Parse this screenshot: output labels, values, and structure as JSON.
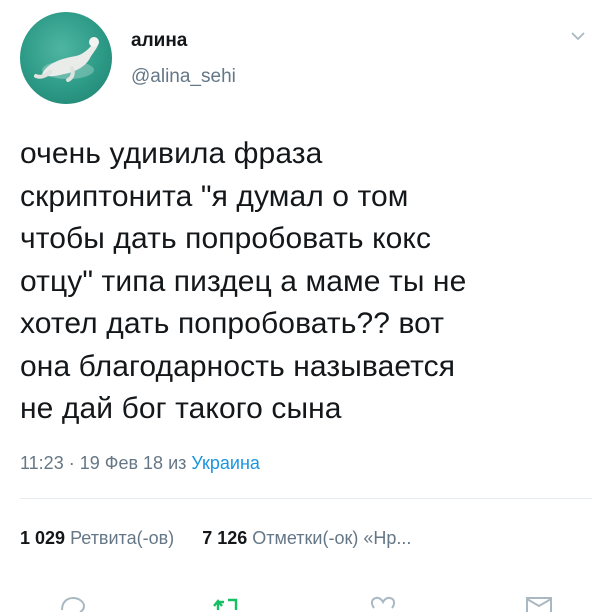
{
  "user": {
    "display_name": "алина",
    "handle": "@alina_sehi"
  },
  "tweet": {
    "lines": [
      "очень удивила фраза",
      "скриптонита \"я думал о том",
      "чтобы дать попробовать кокс",
      "отцу\" типа пиздец а маме ты не",
      "хотел дать попробовать?? вот",
      "она благодарность называется",
      "не дай бог такого сына"
    ],
    "time": "11:23",
    "separator": "·",
    "date": "19 Фев 18",
    "from_label": "из",
    "location": "Украина"
  },
  "stats": {
    "retweets_count": "1 029",
    "retweets_label": "Ретвита(-ов)",
    "likes_count": "7 126",
    "likes_label": "Отметки(-ок)",
    "more_label": "«Нр..."
  },
  "icons": {
    "caret": "chevron-down-icon",
    "reply": "reply-icon",
    "retweet": "retweet-icon",
    "like": "heart-icon",
    "message": "envelope-icon"
  },
  "colors": {
    "link": "#1b95e0",
    "secondary_text": "#657786",
    "retweet_active": "#17bf63",
    "avatar_bg": "#2c9a86"
  }
}
